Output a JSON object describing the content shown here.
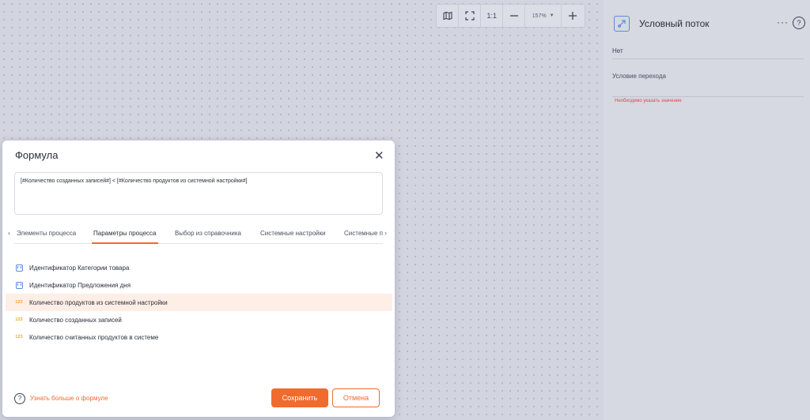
{
  "toolbar": {
    "ratio_label": "1:1",
    "zoom_level": "157%",
    "buttons": [
      "map-icon",
      "fullscreen-icon",
      "reset-ratio",
      "zoom-out-icon",
      "zoom-select",
      "zoom-in-icon"
    ]
  },
  "panel": {
    "icon": "conditional-flow-icon",
    "title": "Условный поток",
    "more_label": "···",
    "help_label": "?",
    "none_value": "Нет",
    "condition_label": "Условие перехода",
    "error_text": "Необходимо указать значение"
  },
  "modal": {
    "title": "Формула",
    "formula_value": "[#Количество созданных записей#] < [#Количество продуктов из системной настройки#]",
    "tabs": [
      {
        "label": "Элементы процесса",
        "active": false
      },
      {
        "label": "Параметры процесса",
        "active": true
      },
      {
        "label": "Выбор из справочника",
        "active": false
      },
      {
        "label": "Системные настройки",
        "active": false
      },
      {
        "label": "Системные переменные",
        "active": false
      }
    ],
    "items": [
      {
        "label": "Идентификатор Категории товара",
        "icon": "id-icon",
        "highlighted": false
      },
      {
        "label": "Идентификатор Предложения дня",
        "icon": "id-icon",
        "highlighted": false
      },
      {
        "label": "Количество продуктов из системной настройки",
        "icon": "number-icon",
        "icon_text": "123",
        "highlighted": true
      },
      {
        "label": "Количество созданных записей",
        "icon": "number-icon",
        "icon_text": "123",
        "highlighted": false
      },
      {
        "label": "Количество считанных продуктов в системе",
        "icon": "number-icon",
        "icon_text": "123",
        "highlighted": false
      }
    ],
    "learn_more": "Узнать больше о формуле",
    "save_label": "Сохранить",
    "cancel_label": "Отмена"
  },
  "colors": {
    "accent": "#f26a2e",
    "error": "#d94a4a",
    "id_icon": "#5b8bd8",
    "number_icon": "#f0a830",
    "highlight_row": "#fdeee6"
  }
}
